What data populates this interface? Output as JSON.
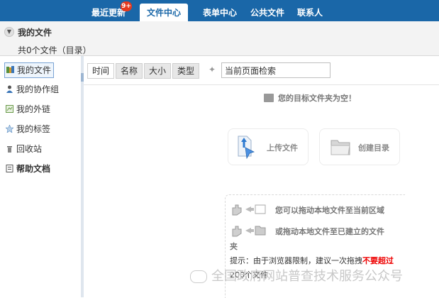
{
  "nav": {
    "items": [
      "最近更新",
      "文件中心",
      "表单中心",
      "公共文件",
      "联系人"
    ],
    "badge": "9+"
  },
  "header": {
    "title": "我的文件",
    "file_count": "共0个文件（目录）"
  },
  "sidebar": {
    "items": [
      {
        "label": "我的文件",
        "icon": "my-files-icon"
      },
      {
        "label": "我的协作组",
        "icon": "group-icon"
      },
      {
        "label": "我的外链",
        "icon": "link-icon"
      },
      {
        "label": "我的标签",
        "icon": "star-icon"
      },
      {
        "label": "回收站",
        "icon": "trash-icon"
      },
      {
        "label": "帮助文档",
        "icon": "help-icon"
      }
    ]
  },
  "toolbar": {
    "sort_buttons": [
      "时间",
      "名称",
      "大小",
      "类型"
    ],
    "search_value": "当前页面检索"
  },
  "main": {
    "empty_message": "您的目标文件夹为空！",
    "upload_label": "上传文件",
    "create_dir_label": "创建目录",
    "drop_hint_1": "您可以拖动本地文件至当前区域",
    "drop_hint_2": "或拖动本地文件至已建立的文件",
    "drop_hint_2b": "夹",
    "tip_prefix": "提示：由于浏览器限制，建议一次拖拽",
    "tip_warn": "不要超过",
    "tip_suffix": "200个文件"
  },
  "watermark": "全国政府网站普查技术服务公众号"
}
